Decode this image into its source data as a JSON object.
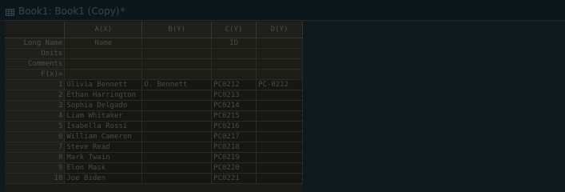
{
  "window": {
    "title": "Book1: Book1 (Copy)",
    "modified_marker": "*"
  },
  "columns": [
    {
      "id": "A",
      "label": "A(X)"
    },
    {
      "id": "B",
      "label": "B(Y)"
    },
    {
      "id": "C",
      "label": "C(Y)"
    },
    {
      "id": "D",
      "label": "D(Y)"
    }
  ],
  "meta_rows": [
    {
      "label": "Long Name",
      "values": [
        "Name",
        "",
        "ID",
        ""
      ]
    },
    {
      "label": "Units",
      "values": [
        "",
        "",
        "",
        ""
      ]
    },
    {
      "label": "Comments",
      "values": [
        "",
        "",
        "",
        ""
      ]
    },
    {
      "label": "F(x)=",
      "values": [
        "",
        "",
        "",
        ""
      ]
    }
  ],
  "rows": [
    {
      "num": "1",
      "cells": [
        "Olivia Bennett",
        "O. Bennett",
        "PC0212",
        "PC-0212"
      ]
    },
    {
      "num": "2",
      "cells": [
        "Ethan Harrington",
        "",
        "PC0213",
        ""
      ]
    },
    {
      "num": "3",
      "cells": [
        "Sophia Delgado",
        "",
        "PC0214",
        ""
      ]
    },
    {
      "num": "4",
      "cells": [
        "Liam Whitaker",
        "",
        "PC0215",
        ""
      ]
    },
    {
      "num": "5",
      "cells": [
        "Isabella Rossi",
        "",
        "PC0216",
        ""
      ]
    },
    {
      "num": "6",
      "cells": [
        "William Cameron",
        "",
        "PC0217",
        ""
      ]
    },
    {
      "num": "7",
      "cells": [
        "Steve Read",
        "",
        "PC0218",
        ""
      ]
    },
    {
      "num": "8",
      "cells": [
        "Mark Twain",
        "",
        "PC0219",
        ""
      ]
    },
    {
      "num": "9",
      "cells": [
        "Elon Mask",
        "",
        "PC0220",
        ""
      ]
    },
    {
      "num": "10",
      "cells": [
        "Joe Biden",
        "",
        "PC0221",
        ""
      ]
    }
  ]
}
